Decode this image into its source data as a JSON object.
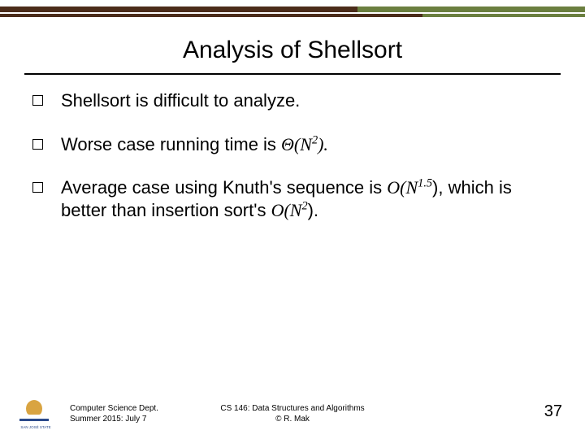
{
  "title": "Analysis of Shellsort",
  "bullets": [
    {
      "text": "Shellsort is difficult to analyze."
    },
    {
      "prefix": "Worse case running time is ",
      "math1": "Θ(N",
      "sup1": "2",
      "suffix1": ")."
    },
    {
      "prefix": "Average case using Knuth's sequence is ",
      "math1": "O(N",
      "sup1": "1.5",
      "mid": "), which is better than insertion sort's ",
      "math2": "O(N",
      "sup2": "2",
      "suffix": ")."
    }
  ],
  "footer": {
    "left_line1": "Computer Science Dept.",
    "left_line2": "Summer 2015: July 7",
    "center_line1": "CS 146: Data Structures and Algorithms",
    "center_line2": "© R. Mak",
    "slide_number": "37",
    "logo_text": "SAN JOSÉ STATE"
  }
}
